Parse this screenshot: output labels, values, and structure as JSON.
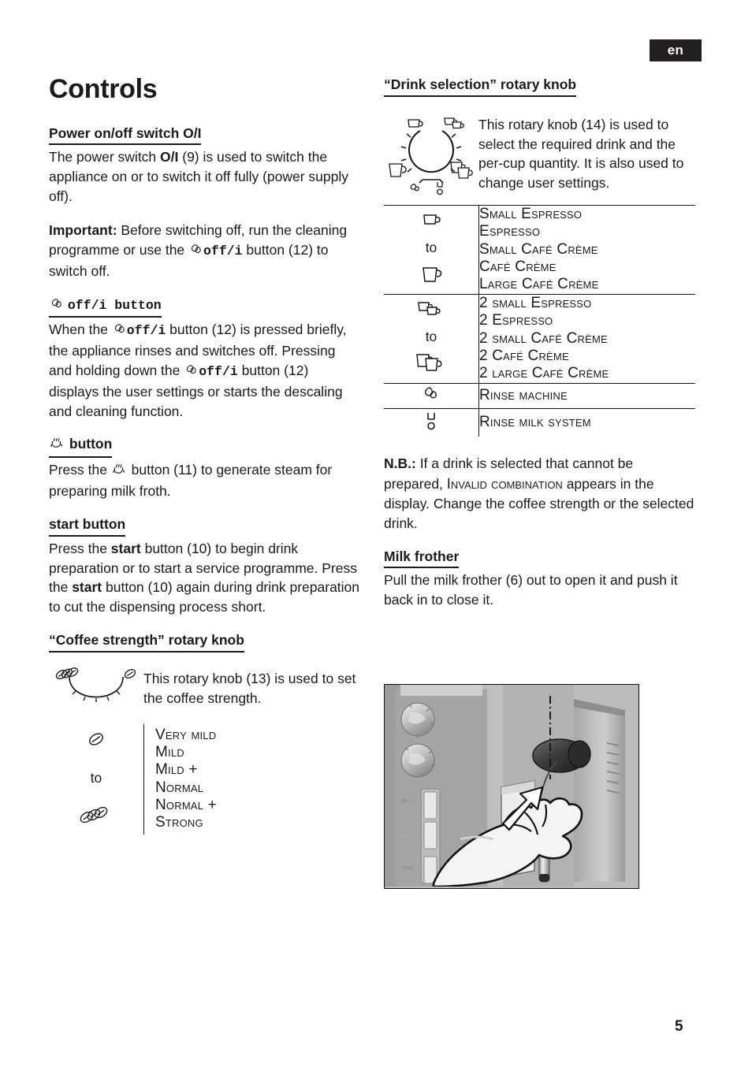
{
  "header": {
    "language_badge": "en"
  },
  "page_number": "5",
  "title": "Controls",
  "left_column": {
    "power_switch": {
      "heading": "Power on/off switch O/I",
      "paragraph_1_pre": "The power switch ",
      "paragraph_1_bold": "O/I",
      "paragraph_1_post": " (9) is used to switch the appliance on or to switch it off fully (power supply off).",
      "important_label": "Important:",
      "important_pre": " Before switching off, run the cleaning programme or use the ",
      "important_bold": "off/i",
      "important_post": " button (12) to switch off."
    },
    "off_button": {
      "heading_bold": "off/i button",
      "paragraph_pre": "When the ",
      "paragraph_bold_1": "off/i",
      "paragraph_mid": " button (12) is pressed briefly, the appliance rinses and switches off. Pressing and holding down the ",
      "paragraph_bold_2": "off/i",
      "paragraph_post": " button (12) displays the user settings or starts the descaling and cleaning function."
    },
    "steam_button": {
      "heading": "button",
      "paragraph_pre": "Press the ",
      "paragraph_post": " button (11) to generate steam for preparing milk froth."
    },
    "start_button": {
      "heading": "start button",
      "paragraph_pre": "Press the ",
      "bold_1": "start",
      "paragraph_mid": " button (10) to begin drink preparation or to start a service programme. Press the ",
      "bold_2": "start",
      "paragraph_post": " button (10) again during drink preparation to cut the dispensing process short."
    },
    "coffee_strength": {
      "heading": "“Coffee strength” rotary knob",
      "description": "This rotary knob (13) is used to set the coffee strength.",
      "to_label": "to",
      "top_icon": "single-coffee-bean-icon",
      "bottom_icon": "triple-coffee-bean-icon",
      "values": [
        "Very mild",
        "Mild",
        "Mild +",
        "Normal",
        "Normal +",
        "Strong"
      ]
    }
  },
  "right_column": {
    "drink_selection": {
      "heading": "“Drink selection” rotary knob",
      "description": "This rotary knob (14) is used to select the required drink and the per-cup quantity. It is also used to change user settings.",
      "to_label": "to",
      "groups": [
        {
          "top_icon": "small-cup-icon",
          "bottom_icon": "large-cup-icon",
          "values": [
            "Small Espresso",
            "Espresso",
            "Small Café Crème",
            "Café Crème",
            "Large Café Crème"
          ]
        },
        {
          "top_icon": "double-small-cup-icon",
          "bottom_icon": "double-large-cup-icon",
          "values": [
            "2 small Espresso",
            "2 Espresso",
            "2 small Café Crème",
            "2 Café Crème",
            "2 large Café Crème"
          ]
        }
      ],
      "rinse_rows": [
        {
          "icon": "water-drop-icon",
          "value": "Rinse machine"
        },
        {
          "icon": "milk-system-icon",
          "value": "Rinse milk system"
        }
      ]
    },
    "note": {
      "label": "N.B.:",
      "pre": " If a drink is selected that cannot be prepared, ",
      "display_message": "Invalid combination",
      "post": " appears in the display. Change the coffee strength or the selected drink."
    },
    "milk_frother": {
      "heading": "Milk frother",
      "paragraph": "Pull the milk frother (6) out to open it and push it back in to close it."
    },
    "photo": {
      "caption_alt": "hand-pulling-milk-frother-illustration"
    }
  },
  "colors": {
    "text": "#1a1a1a",
    "badge_background": "#231f20",
    "badge_text": "#ffffff",
    "rule": "#1a1a1a"
  }
}
